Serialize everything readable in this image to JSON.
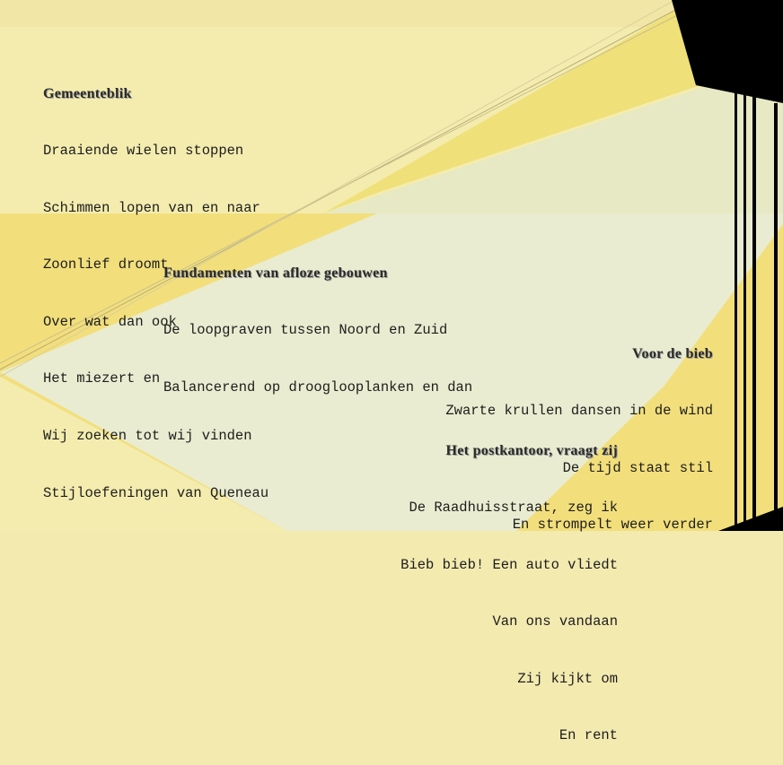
{
  "colors": {
    "pale_yellow": "#f4ecae",
    "yellow": "#f0e07a",
    "pale_green": "#e8ebc8",
    "black": "#000000",
    "text": "#1d1d1d"
  },
  "stanzas": [
    {
      "title": "Gemeenteblik",
      "lines": [
        "Draaiende wielen stoppen",
        "Schimmen lopen van en naar",
        "Zoonlief droomt",
        "Over wat dan ook",
        "Het miezert en",
        "Wij zoeken tot wij vinden",
        "Stijloefeningen van Queneau"
      ]
    },
    {
      "title": "Fundamenten van afloze gebouwen",
      "lines": [
        "De loopgraven tussen Noord en Zuid",
        "Balancerend op drooglooplanken en dan"
      ]
    },
    {
      "title": "Voor de bieb",
      "lines": [
        "Zwarte krullen dansen in de wind",
        "De tijd staat stil",
        "En strompelt weer verder"
      ]
    },
    {
      "title": "Het postkantoor, vraagt zij",
      "lines": [
        "De Raadhuisstraat, zeg ik",
        "Bieb bieb! Een auto vliedt",
        "Van ons vandaan",
        "Zij kijkt om",
        "En rent"
      ]
    }
  ]
}
